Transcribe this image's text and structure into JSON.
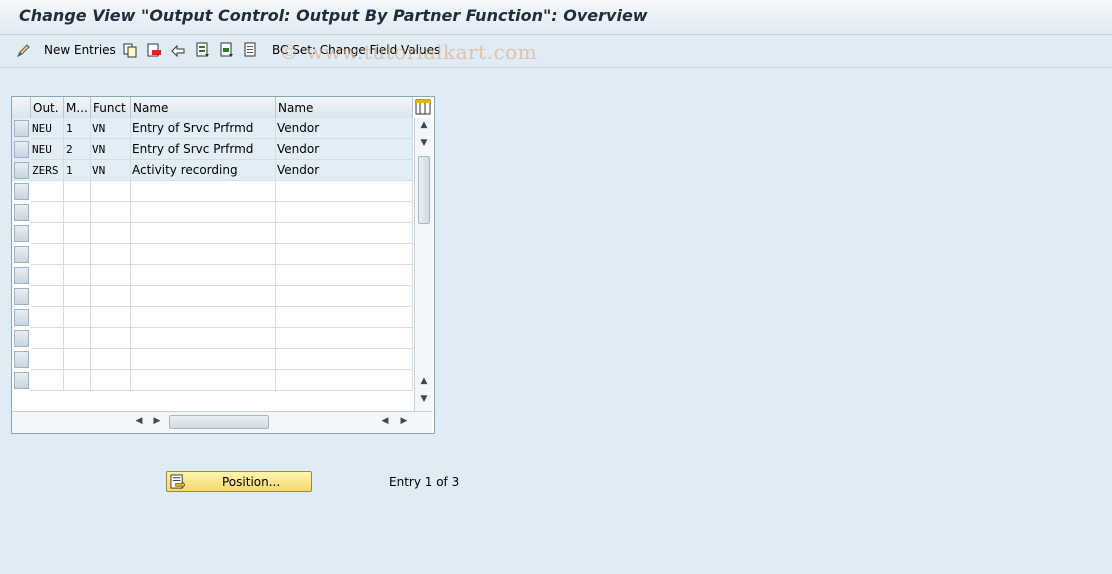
{
  "window": {
    "title": "Change View \"Output Control: Output By Partner Function\": Overview"
  },
  "toolbar": {
    "items": [
      {
        "icon": "edit-pencil-icon"
      },
      {
        "label": "New Entries"
      },
      {
        "icon": "copy-icon"
      },
      {
        "icon": "delete-icon"
      },
      {
        "icon": "undo-change-icon"
      },
      {
        "icon": "select-all-icon"
      },
      {
        "icon": "select-block-icon"
      },
      {
        "icon": "deselect-all-icon"
      },
      {
        "label": "BC Set: Change Field Values"
      }
    ],
    "new_entries_label": "New Entries",
    "bc_set_label": "BC Set: Change Field Values"
  },
  "watermark": "© www.tutorialkart.com",
  "table": {
    "headers": [
      "Out.",
      "M...",
      "Funct",
      "Name",
      "Name"
    ],
    "rows": [
      [
        "NEU",
        "1",
        "VN",
        "Entry of Srvc Prfrmd",
        "Vendor"
      ],
      [
        "NEU",
        "2",
        "VN",
        "Entry of Srvc Prfrmd",
        "Vendor"
      ],
      [
        "ZERS",
        "1",
        "VN",
        "Activity recording",
        "Vendor"
      ]
    ],
    "empty_rows": 10
  },
  "position_button": {
    "label": "Position..."
  },
  "entry_info": "Entry 1 of 3",
  "colors": {
    "background": "#dfebf5",
    "row_fill": "#e1eef8",
    "button": "#f5d96a"
  }
}
